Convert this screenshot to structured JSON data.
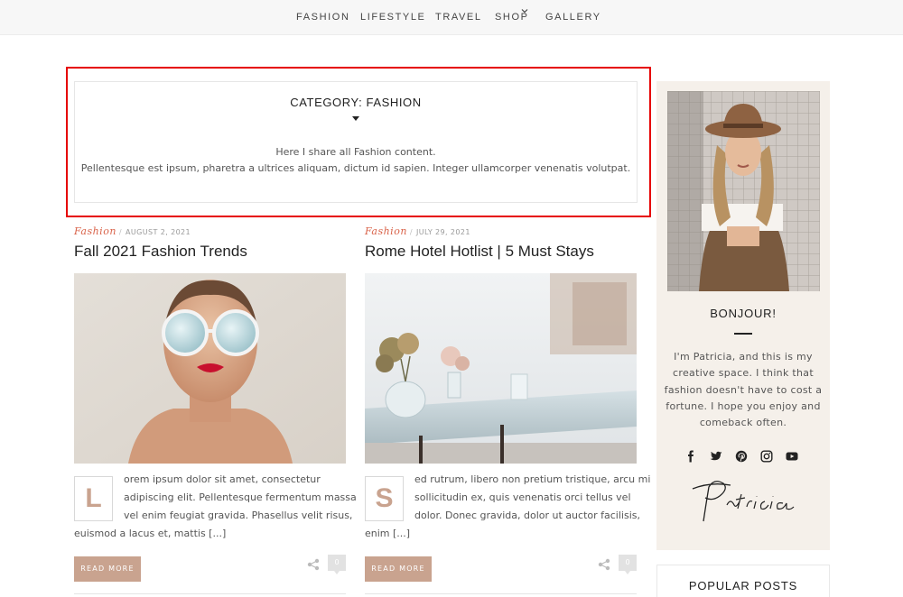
{
  "nav": {
    "items": [
      {
        "label": "FASHION"
      },
      {
        "label": "LIFESTYLE"
      },
      {
        "label": "TRAVEL"
      },
      {
        "label": "SHOP"
      },
      {
        "label": "GALLERY"
      }
    ],
    "shop_caret_icon": "chevron-down-icon"
  },
  "category": {
    "title": "CATEGORY: FASHION",
    "description_line1": "Here I share all Fashion content.",
    "description_line2": "Pellentesque est ipsum, pharetra a ultrices aliquam, dictum id sapien. Integer ullamcorper venenatis volutpat."
  },
  "posts": [
    {
      "category": "Fashion",
      "date": "AUGUST 2, 2021",
      "title": "Fall 2021 Fashion Trends",
      "dropcap": "L",
      "excerpt_lines": [
        "orem ipsum dolor sit amet, consectetur",
        "adipiscing elit. Pellentesque fermentum massa",
        "vel enim feugiat gravida. Phasellus velit risus,",
        "euismod a lacus et, mattis [...]"
      ],
      "read_more": "READ MORE",
      "comments": "0"
    },
    {
      "category": "Fashion",
      "date": "JULY 29, 2021",
      "title": "Rome Hotel Hotlist | 5 Must Stays",
      "dropcap": "S",
      "excerpt_lines": [
        "ed rutrum, libero non pretium tristique, arcu mi",
        "sollicitudin ex, quis venenatis orci tellus vel",
        "dolor. Donec gravida, dolor ut auctor facilisis,",
        "enim [...]"
      ],
      "read_more": "READ MORE",
      "comments": "0"
    }
  ],
  "sidebar": {
    "heading": "BONJOUR!",
    "bio_lines": [
      "I'm Patricia, and this is my",
      "creative space. I think that",
      "fashion doesn't have to cost a",
      "fortune. I hope you enjoy and",
      "comeback often."
    ],
    "signature": "Patricia",
    "social_icons": [
      "facebook-icon",
      "twitter-icon",
      "pinterest-icon",
      "instagram-icon",
      "youtube-icon"
    ],
    "popular_title": "POPULAR POSTS"
  },
  "colors": {
    "accent": "#c9a38f",
    "category_link": "#d9634a",
    "highlight_frame": "#e60000",
    "sidebar_bg": "#f5f0ea"
  }
}
